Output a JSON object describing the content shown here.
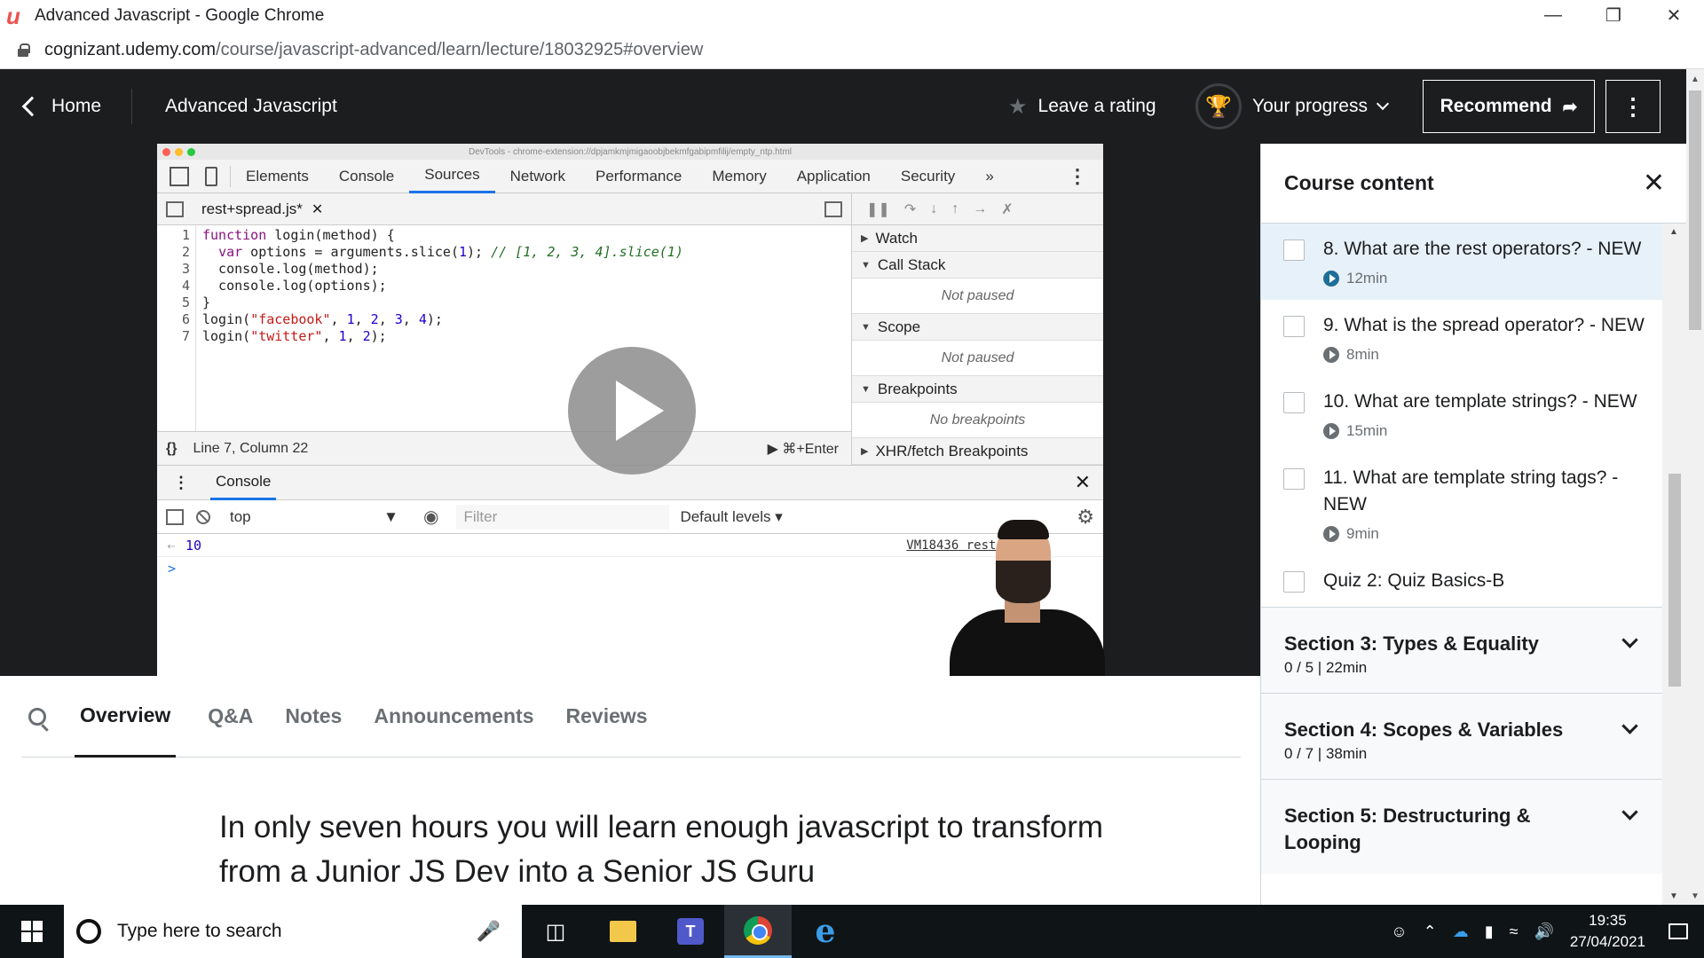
{
  "window": {
    "title": "Advanced Javascript - Google Chrome",
    "url_host": "cognizant.udemy.com",
    "url_path": "/course/javascript-advanced/learn/lecture/18032925#overview"
  },
  "header": {
    "home_label": "Home",
    "course_title": "Advanced Javascript",
    "rating_label": "Leave a rating",
    "progress_label": "Your progress",
    "recommend_label": "Recommend"
  },
  "devtools": {
    "window_title": "DevTools - chrome-extension://dpjamkmjmigaoobjbekmfgabipmfilij/empty_ntp.html",
    "tabs": [
      "Elements",
      "Console",
      "Sources",
      "Network",
      "Performance",
      "Memory",
      "Application",
      "Security"
    ],
    "active_tab": "Sources",
    "file_tab": "rest+spread.js*",
    "line_numbers": [
      "1",
      "2",
      "3",
      "4",
      "5",
      "6",
      "7"
    ],
    "status": "Line 7, Column 22",
    "run_hint": "⌘+Enter",
    "panels": {
      "watch": "Watch",
      "call_stack": "Call Stack",
      "call_stack_info": "Not paused",
      "scope": "Scope",
      "scope_info": "Not paused",
      "breakpoints": "Breakpoints",
      "breakpoints_info": "No breakpoints",
      "xhr": "XHR/fetch Breakpoints"
    },
    "console_tab": "Console",
    "context": "top",
    "filter_placeholder": "Filter",
    "levels": "Default levels ▾",
    "output_value": "10",
    "output_source": "VM18436 rest+sprea"
  },
  "course_nav": {
    "tabs": [
      "Overview",
      "Q&A",
      "Notes",
      "Announcements",
      "Reviews"
    ],
    "active": "Overview"
  },
  "overview_text": "In only seven hours you will learn enough javascript to transform from a Junior JS Dev into a Senior JS Guru",
  "sidebar": {
    "title": "Course content",
    "items": [
      {
        "title": "8. What are the rest operators? - NEW",
        "duration": "12min",
        "active": true
      },
      {
        "title": "9. What is the spread operator? - NEW",
        "duration": "8min"
      },
      {
        "title": "10. What are template strings? - NEW",
        "duration": "15min"
      },
      {
        "title": "11. What are template string tags? - NEW",
        "duration": "9min"
      },
      {
        "title": "Quiz 2: Quiz Basics-B",
        "duration": ""
      }
    ],
    "sections": [
      {
        "title": "Section 3: Types & Equality",
        "meta": "0 / 5 | 22min"
      },
      {
        "title": "Section 4: Scopes & Variables",
        "meta": "0 / 7 | 38min"
      },
      {
        "title": "Section 5: Destructuring & Looping",
        "meta": ""
      }
    ]
  },
  "taskbar": {
    "search_placeholder": "Type here to search",
    "time": "19:35",
    "date": "27/04/2021"
  },
  "colors": {
    "udemy_dark": "#1c1d1f",
    "devtools_accent": "#1a73e8",
    "active_lecture_bg": "#e7f1f9"
  }
}
